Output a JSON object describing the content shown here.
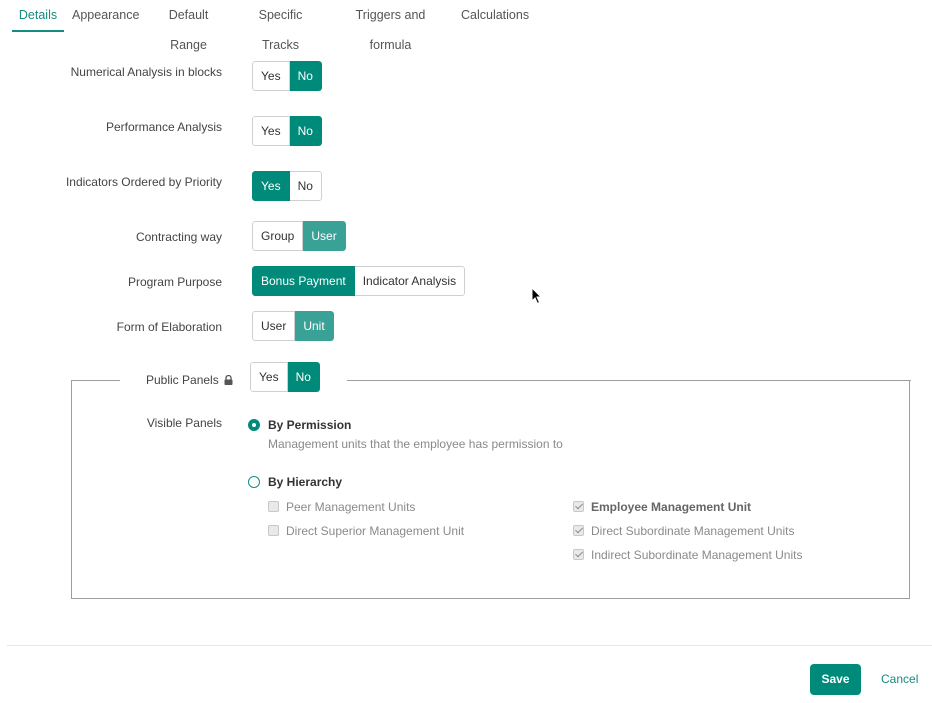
{
  "tabs": [
    "Details",
    "Appearance",
    "Default Range",
    "Specific Tracks",
    "Triggers and formula",
    "Calculations"
  ],
  "fields": {
    "numerical": {
      "label": "Numerical Analysis in blocks",
      "options": [
        "Yes",
        "No"
      ],
      "selected": "No"
    },
    "performance": {
      "label": "Performance Analysis",
      "options": [
        "Yes",
        "No"
      ],
      "selected": "No"
    },
    "indicators": {
      "label": "Indicators Ordered by Priority",
      "options": [
        "Yes",
        "No"
      ],
      "selected": "Yes"
    },
    "contracting": {
      "label": "Contracting way",
      "options": [
        "Group",
        "User"
      ],
      "selected": "User"
    },
    "purpose": {
      "label": "Program Purpose",
      "options": [
        "Bonus Payment",
        "Indicator Analysis"
      ],
      "selected": "Bonus Payment"
    },
    "elaboration": {
      "label": "Form of Elaboration",
      "options": [
        "User",
        "Unit"
      ],
      "selected": "Unit"
    }
  },
  "public_panels": {
    "label": "Public Panels",
    "icon": "lock-icon",
    "options": [
      "Yes",
      "No"
    ],
    "selected": "No",
    "visible_panels": {
      "label": "Visible Panels",
      "by_permission": {
        "label": "By Permission",
        "description": "Management units that the employee has permission to",
        "checked": true
      },
      "by_hierarchy": {
        "label": "By Hierarchy",
        "checked": false,
        "left": [
          {
            "label": "Peer Management Units",
            "checked": false
          },
          {
            "label": "Direct Superior Management Unit",
            "checked": false
          }
        ],
        "right": [
          {
            "label": "Employee Management Unit",
            "checked": true
          },
          {
            "label": "Direct Subordinate Management Units",
            "checked": true
          },
          {
            "label": "Indirect Subordinate Management Units",
            "checked": true
          }
        ]
      }
    }
  },
  "footer": {
    "save": "Save",
    "cancel": "Cancel"
  },
  "colors": {
    "accent": "#008a7a",
    "accent_light": "#3aa197",
    "link": "#168c80"
  }
}
